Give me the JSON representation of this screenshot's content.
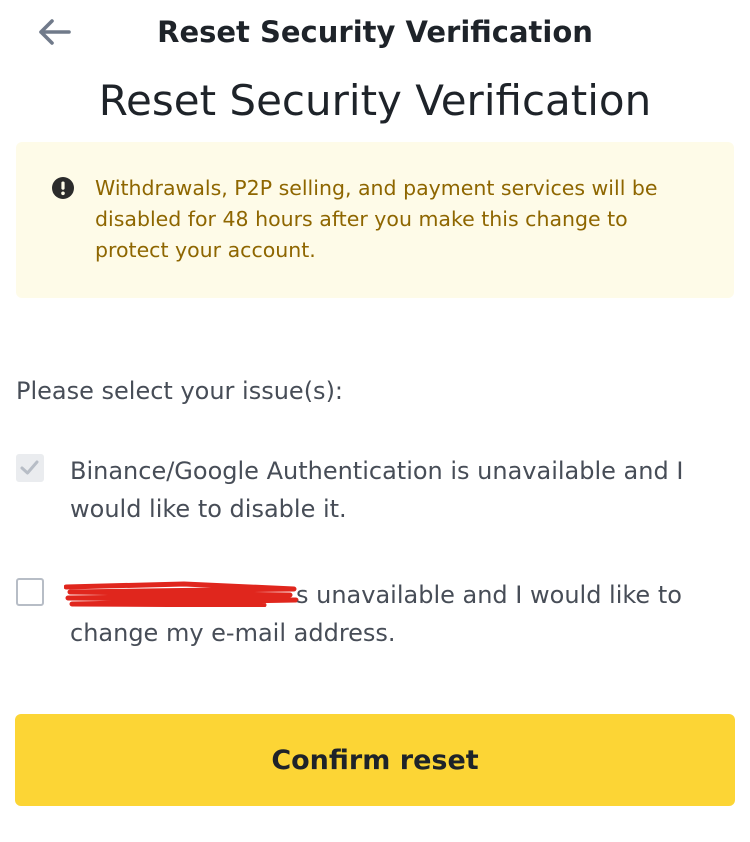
{
  "header": {
    "title": "Reset Security Verification",
    "back_icon": "arrow-left-icon"
  },
  "page": {
    "title": "Reset Security Verification"
  },
  "notice": {
    "icon": "exclamation-circle-icon",
    "text": "Withdrawals, P2P selling, and payment services will be disabled for 48 hours after you make this change to protect your account."
  },
  "form": {
    "prompt": "Please select your issue(s):",
    "options": [
      {
        "text": "Binance/Google Authentication is unavailable and I would like to disable it.",
        "checked": true
      },
      {
        "text_visible": "s unavailable and I would like to change my e-mail address.",
        "checked": false,
        "redacted": true
      }
    ]
  },
  "actions": {
    "confirm_label": "Confirm reset"
  },
  "colors": {
    "accent_yellow": "#fcd535",
    "notice_bg": "#fefbe8",
    "notice_text": "#8e6600",
    "redaction_red": "#e0261d"
  }
}
